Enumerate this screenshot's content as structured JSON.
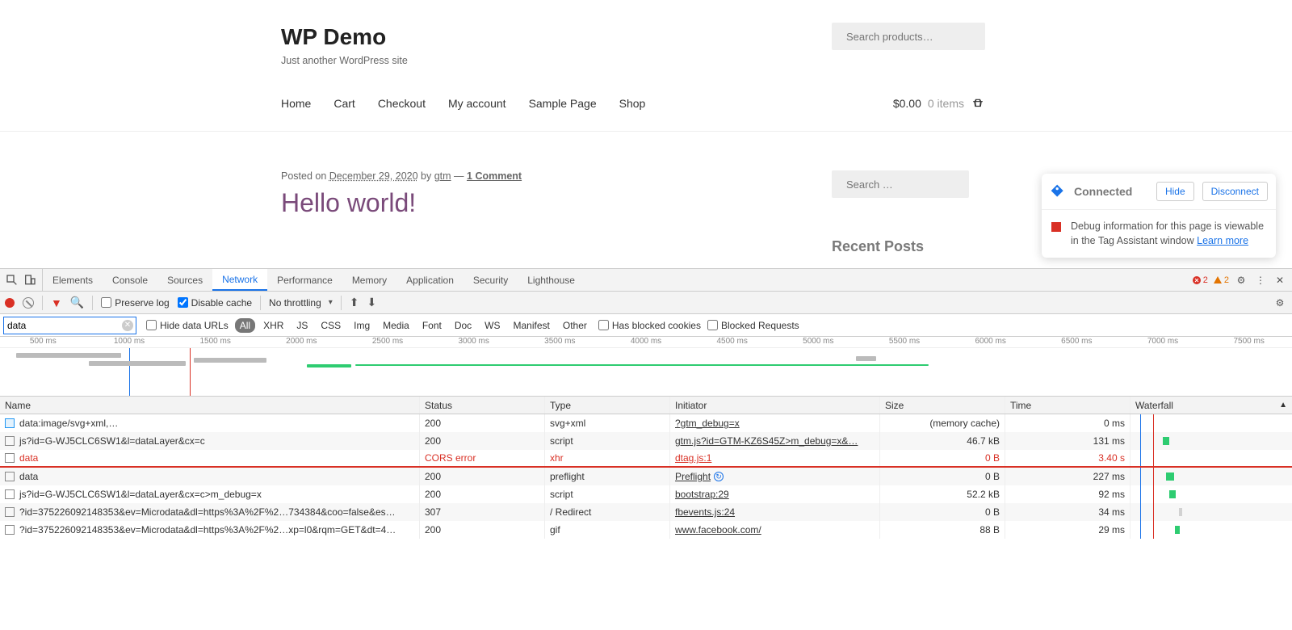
{
  "wp": {
    "title": "WP Demo",
    "tagline": "Just another WordPress site",
    "search_placeholder": "Search products…",
    "nav": [
      "Home",
      "Cart",
      "Checkout",
      "My account",
      "Sample Page",
      "Shop"
    ],
    "price": "$0.00",
    "items": "0 items",
    "meta_posted_on": "Posted on ",
    "meta_date": "December 29, 2020",
    "meta_by": " by ",
    "meta_author": "gtm",
    "meta_sep": " — ",
    "meta_comments": "1 Comment",
    "post_title": "Hello world!",
    "side_search_placeholder": "Search …",
    "recent": "Recent Posts"
  },
  "tag": {
    "status": "Connected",
    "hide": "Hide",
    "disconnect": "Disconnect",
    "body": "Debug information for this page is viewable in the Tag Assistant window ",
    "learn": "Learn more"
  },
  "dt": {
    "tabs": [
      "Elements",
      "Console",
      "Sources",
      "Network",
      "Performance",
      "Memory",
      "Application",
      "Security",
      "Lighthouse"
    ],
    "active_tab": "Network",
    "err_count": "2",
    "warn_count": "2",
    "preserve_log": "Preserve log",
    "disable_cache": "Disable cache",
    "throttle": "No throttling",
    "filter_value": "data",
    "hide_data_urls": "Hide data URLs",
    "filter_types": [
      "All",
      "XHR",
      "JS",
      "CSS",
      "Img",
      "Media",
      "Font",
      "Doc",
      "WS",
      "Manifest",
      "Other"
    ],
    "blocked_cookies": "Has blocked cookies",
    "blocked_requests": "Blocked Requests",
    "ruler": [
      "500 ms",
      "1000 ms",
      "1500 ms",
      "2000 ms",
      "2500 ms",
      "3000 ms",
      "3500 ms",
      "4000 ms",
      "4500 ms",
      "5000 ms",
      "5500 ms",
      "6000 ms",
      "6500 ms",
      "7000 ms",
      "7500 ms"
    ],
    "columns": [
      "Name",
      "Status",
      "Type",
      "Initiator",
      "Size",
      "Time",
      "Waterfall"
    ],
    "rows": [
      {
        "name": "data:image/svg+xml,…",
        "status": "200",
        "type": "svg+xml",
        "initiator": "?gtm_debug=x",
        "size": "(memory cache)",
        "time": "0 ms",
        "err": false,
        "icon": "blue"
      },
      {
        "name": "js?id=G-WJ5CLC6SW1&l=dataLayer&cx=c",
        "status": "200",
        "type": "script",
        "initiator": "gtm.js?id=GTM-KZ6S45Z&gtm_debug=x&…",
        "size": "46.7 kB",
        "time": "131 ms",
        "err": false,
        "icon": ""
      },
      {
        "name": "data",
        "status": "CORS error",
        "type": "xhr",
        "initiator": "dtag.js:1",
        "size": "0 B",
        "time": "3.40 s",
        "err": true,
        "icon": ""
      },
      {
        "name": "data",
        "status": "200",
        "type": "preflight",
        "initiator": "Preflight",
        "size": "0 B",
        "time": "227 ms",
        "err": false,
        "icon": "",
        "refresh": true
      },
      {
        "name": "js?id=G-WJ5CLC6SW1&l=dataLayer&cx=c&gtm_debug=x",
        "status": "200",
        "type": "script",
        "initiator": "bootstrap:29",
        "size": "52.2 kB",
        "time": "92 ms",
        "err": false,
        "icon": ""
      },
      {
        "name": "?id=375226092148353&ev=Microdata&dl=https%3A%2F%2…734384&coo=false&es…",
        "status": "307",
        "type": "/ Redirect",
        "initiator": "fbevents.js:24",
        "size": "0 B",
        "time": "34 ms",
        "err": false,
        "icon": ""
      },
      {
        "name": "?id=375226092148353&ev=Microdata&dl=https%3A%2F%2…xp=l0&rqm=GET&dt=4…",
        "status": "200",
        "type": "gif",
        "initiator": "www.facebook.com/",
        "size": "88 B",
        "time": "29 ms",
        "err": false,
        "icon": ""
      }
    ]
  }
}
